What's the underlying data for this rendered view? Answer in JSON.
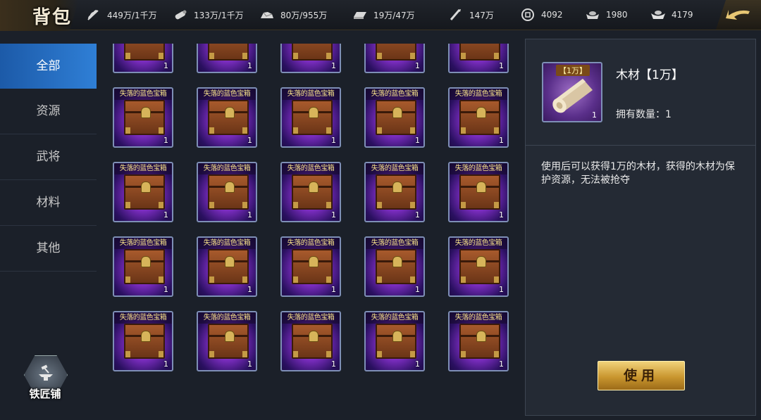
{
  "header": {
    "title": "背包",
    "resources": [
      {
        "icon": "wheat-icon",
        "value": "449万/1千万"
      },
      {
        "icon": "wood-log-icon",
        "value": "133万/1千万"
      },
      {
        "icon": "stone-icon",
        "value": "80万/955万"
      },
      {
        "icon": "iron-ingot-icon",
        "value": "19万/47万"
      },
      {
        "icon": "order-token-icon",
        "value": "147万"
      },
      {
        "icon": "coin-icon",
        "value": "4092"
      },
      {
        "icon": "gold-ingot-icon",
        "value": "1980"
      },
      {
        "icon": "silver-ingot-icon",
        "value": "4179"
      }
    ]
  },
  "sidebar": {
    "items": [
      {
        "label": "全部",
        "active": true
      },
      {
        "label": "资源",
        "active": false
      },
      {
        "label": "武将",
        "active": false
      },
      {
        "label": "材料",
        "active": false
      },
      {
        "label": "其他",
        "active": false
      }
    ],
    "blacksmith_label": "铁匠铺"
  },
  "grid": {
    "item_name": "失落的蓝色宝箱",
    "item_count": "1"
  },
  "detail": {
    "tag": "【1万】",
    "count": "1",
    "name": "木材【1万】",
    "owned": "拥有数量：1",
    "description": "使用后可以获得1万的木材，获得的木材为保护资源，无法被抢夺",
    "use_label": "使用"
  },
  "colors": {
    "nav_active": "#2f7fd6",
    "button_gold": "#c9962f",
    "slot_border": "#7e8fb6",
    "slot_purple": "#7e2ec3"
  }
}
